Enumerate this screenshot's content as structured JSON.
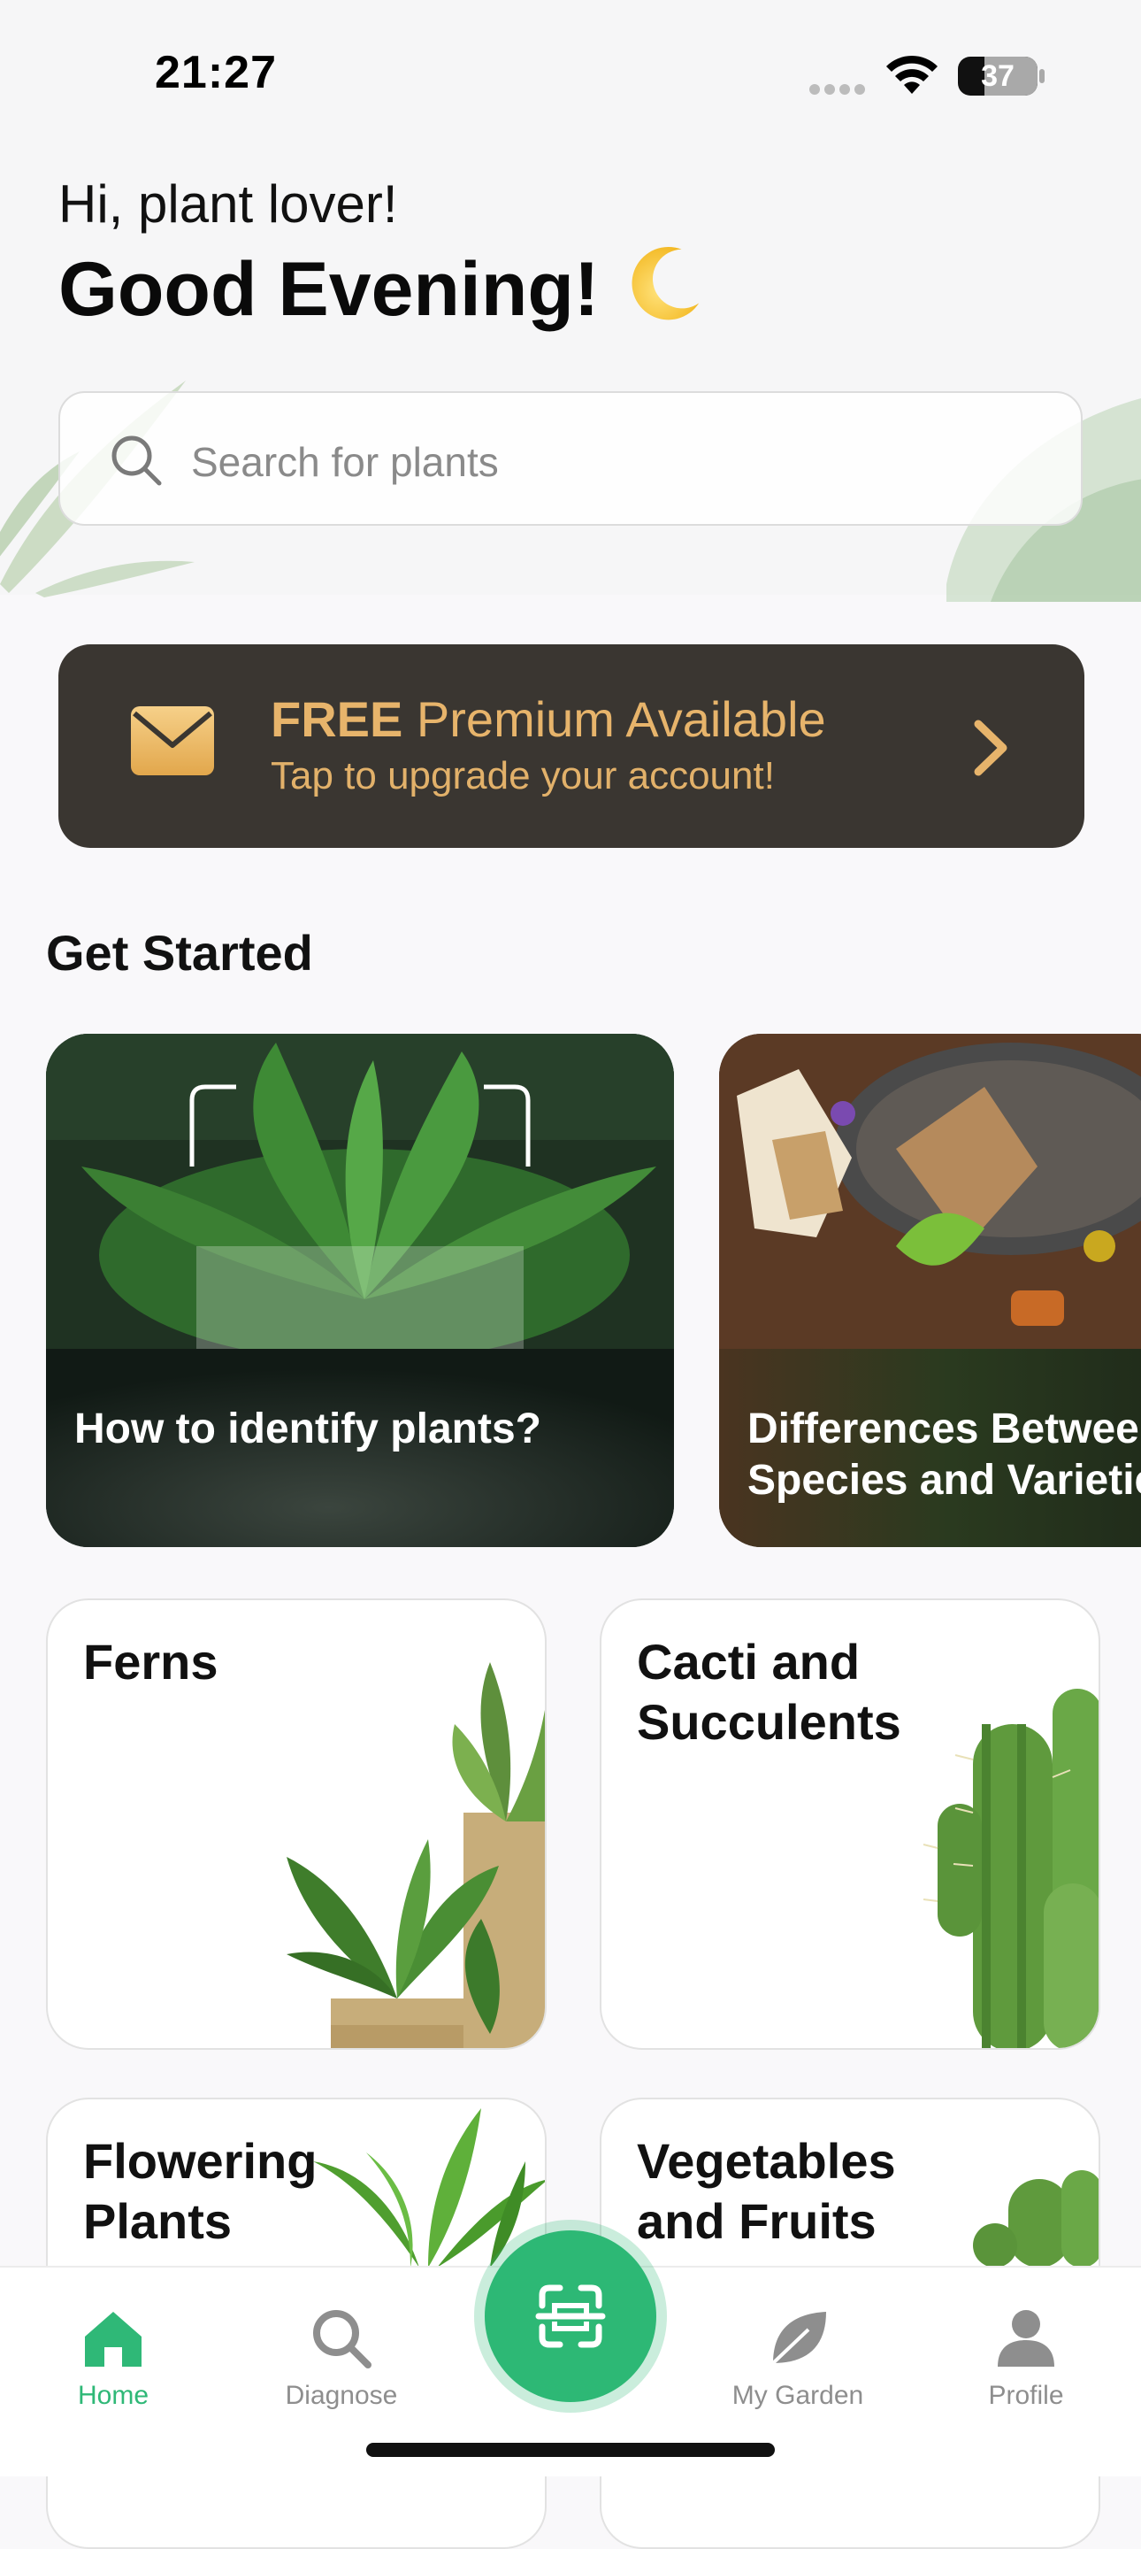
{
  "status": {
    "time": "21:27",
    "battery": "37"
  },
  "header": {
    "greeting": "Hi, plant lover!",
    "headline": "Good Evening!"
  },
  "search": {
    "placeholder": "Search for plants"
  },
  "premium": {
    "title_bold": "FREE",
    "title_rest": "Premium Available",
    "subtitle": "Tap to upgrade your account!"
  },
  "get_started": {
    "title": "Get Started",
    "cards": [
      {
        "label": "How to identify plants?"
      },
      {
        "label_line1": "Differences Betwee",
        "label_line2": "Species and Varietie"
      }
    ]
  },
  "categories": [
    {
      "line1": "Ferns",
      "line2": ""
    },
    {
      "line1": "Cacti and",
      "line2": "Succulents"
    },
    {
      "line1": "Flowering",
      "line2": "Plants"
    },
    {
      "line1": "Vegetables",
      "line2": "and Fruits"
    }
  ],
  "nav": {
    "items": [
      {
        "label": "Home"
      },
      {
        "label": "Diagnose"
      },
      {
        "label": "My Garden"
      },
      {
        "label": "Profile"
      }
    ]
  },
  "colors": {
    "accent": "#2db875",
    "premium_bg": "#3a3631",
    "premium_text": "#e7b46b"
  }
}
